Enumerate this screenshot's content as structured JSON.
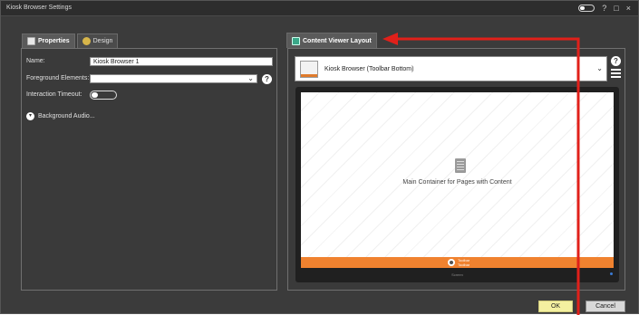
{
  "window": {
    "title": "Kiosk Browser Settings",
    "controls": [
      "toggle-icon",
      "?",
      "□",
      "×"
    ]
  },
  "left_tabs": [
    {
      "label": "Properties",
      "icon": "properties-icon",
      "active": true
    },
    {
      "label": "Design",
      "icon": "design-icon",
      "active": false
    }
  ],
  "form": {
    "name_label": "Name:",
    "name_value": "Kiosk Browser 1",
    "foreground_label": "Foreground Elements:",
    "foreground_value": "",
    "timeout_label": "Interaction Timeout:",
    "timeout_on": false,
    "background_audio_label": "Background Audio..."
  },
  "right_tab": {
    "label": "Content Viewer Layout",
    "icon": "layout-icon"
  },
  "layout_select": {
    "value": "Kiosk Browser (Toolbar Bottom)"
  },
  "preview": {
    "main_label": "Main Container for Pages with Content",
    "toolbar_line1": "Toolbar",
    "toolbar_line2": "Toolbar",
    "footer_text": "Screen"
  },
  "buttons": {
    "ok": "OK",
    "cancel": "Cancel"
  },
  "colors": {
    "toolbar_orange": "#f0822f",
    "ok_yellow": "#f4f0a0",
    "annotation_red": "#e0201a"
  }
}
